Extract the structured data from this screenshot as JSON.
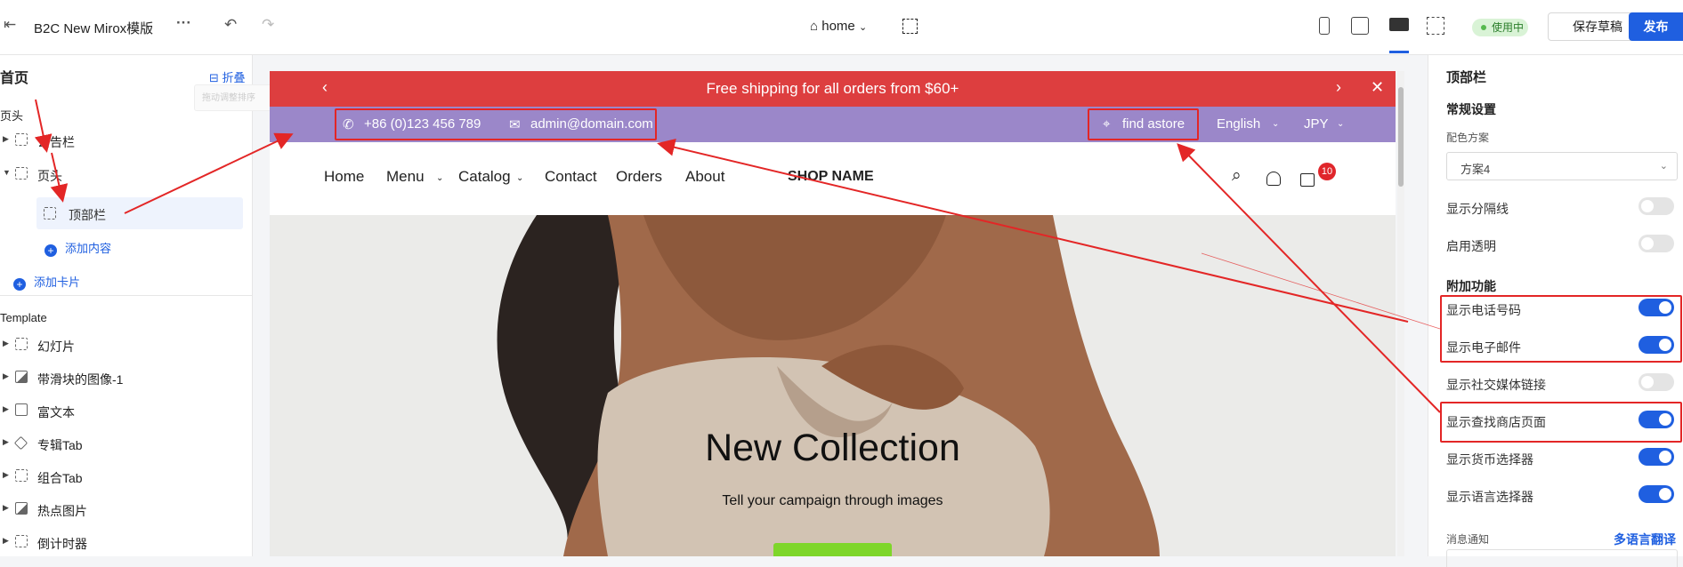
{
  "topbar": {
    "app_title": "B2C New Mirox模版",
    "page_selector": "home",
    "status": "使用中",
    "save_draft": "保存草稿",
    "publish": "发布"
  },
  "left_panel": {
    "title": "首页",
    "collapse_label": "折叠",
    "ghost_hint": "拖动调整排序",
    "header_section": "页头",
    "header_items": [
      {
        "label": "公告栏",
        "icon": "dashed-frame-icon"
      },
      {
        "label": "页头",
        "icon": "dashed-frame-icon"
      }
    ],
    "child_item": "顶部栏",
    "add_content": "添加内容",
    "add_card": "添加卡片",
    "template_section": "Template",
    "template_items": [
      {
        "label": "幻灯片",
        "icon": "dashed-frame-icon"
      },
      {
        "label": "带滑块的图像-1",
        "icon": "image-icon"
      },
      {
        "label": "富文本",
        "icon": "document-icon"
      },
      {
        "label": "专辑Tab",
        "icon": "tag-icon"
      },
      {
        "label": "组合Tab",
        "icon": "dashed-frame-icon"
      },
      {
        "label": "热点图片",
        "icon": "image-icon"
      },
      {
        "label": "倒计时器",
        "icon": "dashed-frame-icon"
      }
    ]
  },
  "preview": {
    "announcement": "Free shipping for all orders from $60+",
    "phone": "+86 (0)123 456 789",
    "email": "admin@domain.com",
    "find_store": "find astore",
    "language": "English",
    "currency": "JPY",
    "nav": [
      "Home",
      "Menu",
      "Catalog",
      "Contact",
      "Orders",
      "About"
    ],
    "shop_name": "SHOP NAME",
    "cart_count": "10",
    "hero_title": "New Collection",
    "hero_subtitle": "Tell your campaign through images",
    "colors": {
      "announcement_bg": "#dd3e3f",
      "infobar_bg": "#9b87c9",
      "hero_button": "#7ed62a"
    }
  },
  "right_panel": {
    "title": "顶部栏",
    "general_section": "常规设置",
    "color_scheme_label": "配色方案",
    "color_scheme_value": "方案4",
    "toggles_general": [
      {
        "label": "显示分隔线",
        "on": false
      },
      {
        "label": "启用透明",
        "on": false
      }
    ],
    "extra_section": "附加功能",
    "toggles_extra": [
      {
        "label": "显示电话号码",
        "on": true
      },
      {
        "label": "显示电子邮件",
        "on": true
      },
      {
        "label": "显示社交媒体链接",
        "on": false
      },
      {
        "label": "显示查找商店页面",
        "on": true
      },
      {
        "label": "显示货币选择器",
        "on": true
      },
      {
        "label": "显示语言选择器",
        "on": true
      }
    ],
    "message_label": "消息通知",
    "translate_link": "多语言翻译",
    "accent": "#1f5fe0"
  }
}
